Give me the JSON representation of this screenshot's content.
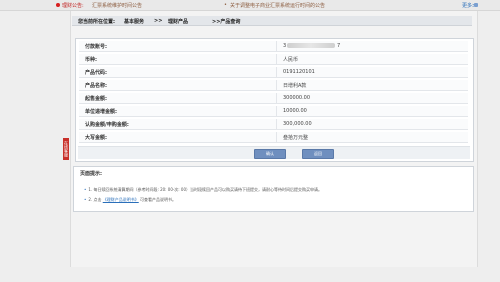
{
  "top_bar": {
    "label": "理财公告:",
    "notice_1": "汇票系统维护时间公告",
    "bullet": "•",
    "notice_2": "关于调整电子商业汇票系统运行时间的公告",
    "more": "更多>"
  },
  "side_tab": {
    "label": "在线客服"
  },
  "breadcrumb": {
    "prefix": "您当前所在位置:",
    "level1": "基本服务",
    "sep": ">>",
    "level2": "理财产品",
    "level3": ">>产品查询"
  },
  "form": {
    "rows": [
      {
        "key": "付款账号:",
        "value": "3",
        "tail": "7",
        "masked": true
      },
      {
        "key": "币种:",
        "value": "人民币"
      },
      {
        "key": "产品代码:",
        "value": "0191120101"
      },
      {
        "key": "产品名称:",
        "value": "日增利A款"
      },
      {
        "key": "起售金额:",
        "value": "300000.00"
      },
      {
        "key": "单位递增金额:",
        "value": "10000.00"
      },
      {
        "key": "认购金额/申购金额:",
        "value": "300,000.00"
      },
      {
        "key": "大写金额:",
        "value": "叁拾万元整"
      }
    ],
    "confirm_label": "确认",
    "back_label": "返回"
  },
  "tips": {
    "title": "页面提示:",
    "line1": "1.  每日赎回系统清算期间（参考时间段: 20: 00-次: 00）当时段赎回产品可以购买请待下班提交，请耐心等待时间后提交购买申请。",
    "line2_prefix": "2.  点击",
    "line2_link": "《理财产品说明书》",
    "line2_suffix": "可查看产品说明书。"
  },
  "colors": {
    "accent_red": "#c0201f",
    "link_blue": "#2a6fba",
    "button_blue": "#6f8fbf"
  }
}
